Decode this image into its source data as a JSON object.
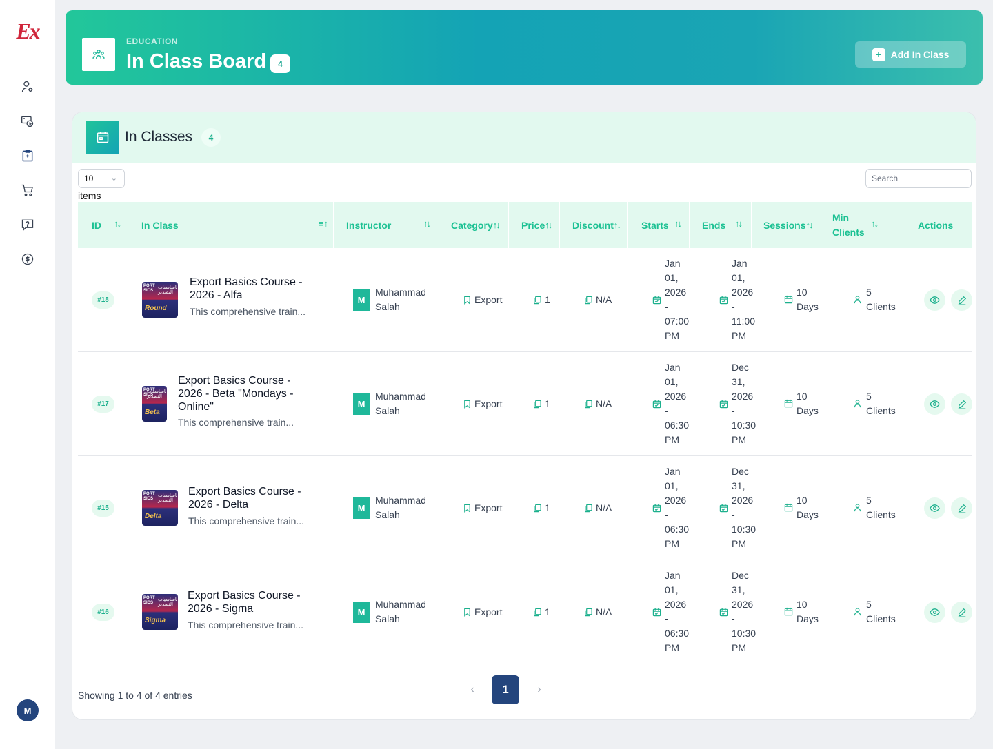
{
  "app": {
    "logo_text": "Ex",
    "user_initial": "M"
  },
  "sidebar": {
    "items": [
      {
        "icon": "user-gear-icon"
      },
      {
        "icon": "money-transfer-icon"
      },
      {
        "icon": "clipboard-icon",
        "active": true
      },
      {
        "icon": "cart-icon"
      },
      {
        "icon": "question-icon"
      },
      {
        "icon": "dollar-icon"
      }
    ]
  },
  "header": {
    "section": "EDUCATION",
    "title": "In Class Board",
    "count": "4",
    "add_button": "Add In Class"
  },
  "card": {
    "title": "In Classes",
    "count": "4",
    "page_length": "10",
    "page_length_label": "items",
    "search_placeholder": "Search"
  },
  "table": {
    "columns": {
      "id": "ID",
      "in_class": "In Class",
      "instructor": "Instructor",
      "category": "Category",
      "price": "Price",
      "discount": "Discount",
      "starts": "Starts",
      "ends": "Ends",
      "sessions": "Sessions",
      "min_clients_1": "Min",
      "min_clients_2": "Clients",
      "actions": "Actions"
    },
    "rows": [
      {
        "id": "#18",
        "thumb_label": "Round",
        "title_1": "Export Basics Course -",
        "title_2": "2026 - Alfa",
        "title_3": "",
        "desc": "This comprehensive train...",
        "instructor_initial": "M",
        "instructor_1": "Muhammad",
        "instructor_2": "Salah",
        "category": "Export",
        "price": "1",
        "discount": "N/A",
        "starts": [
          "Jan",
          "01,",
          "2026",
          "-",
          "07:00",
          "PM"
        ],
        "ends": [
          "Jan",
          "01,",
          "2026",
          "-",
          "11:00",
          "PM"
        ],
        "sessions_1": "10",
        "sessions_2": "Days",
        "clients_1": "5",
        "clients_2": "Clients"
      },
      {
        "id": "#17",
        "thumb_label": "Beta",
        "title_1": "Export Basics Course -",
        "title_2": "2026 - Beta \"Mondays -",
        "title_3": "Online\"",
        "desc": "This comprehensive train...",
        "instructor_initial": "M",
        "instructor_1": "Muhammad",
        "instructor_2": "Salah",
        "category": "Export",
        "price": "1",
        "discount": "N/A",
        "starts": [
          "Jan",
          "01,",
          "2026",
          "-",
          "06:30",
          "PM"
        ],
        "ends": [
          "Dec",
          "31,",
          "2026",
          "-",
          "10:30",
          "PM"
        ],
        "sessions_1": "10",
        "sessions_2": "Days",
        "clients_1": "5",
        "clients_2": "Clients"
      },
      {
        "id": "#15",
        "thumb_label": "Delta",
        "title_1": "Export Basics Course -",
        "title_2": "2026 - Delta",
        "title_3": "",
        "desc": "This comprehensive train...",
        "instructor_initial": "M",
        "instructor_1": "Muhammad",
        "instructor_2": "Salah",
        "category": "Export",
        "price": "1",
        "discount": "N/A",
        "starts": [
          "Jan",
          "01,",
          "2026",
          "-",
          "06:30",
          "PM"
        ],
        "ends": [
          "Dec",
          "31,",
          "2026",
          "-",
          "10:30",
          "PM"
        ],
        "sessions_1": "10",
        "sessions_2": "Days",
        "clients_1": "5",
        "clients_2": "Clients"
      },
      {
        "id": "#16",
        "thumb_label": "Sigma",
        "title_1": "Export Basics Course -",
        "title_2": "2026 - Sigma",
        "title_3": "",
        "desc": "This comprehensive train...",
        "instructor_initial": "M",
        "instructor_1": "Muhammad",
        "instructor_2": "Salah",
        "category": "Export",
        "price": "1",
        "discount": "N/A",
        "starts": [
          "Jan",
          "01,",
          "2026",
          "-",
          "06:30",
          "PM"
        ],
        "ends": [
          "Dec",
          "31,",
          "2026",
          "-",
          "10:30",
          "PM"
        ],
        "sessions_1": "10",
        "sessions_2": "Days",
        "clients_1": "5",
        "clients_2": "Clients"
      }
    ]
  },
  "pagination": {
    "summary": "Showing 1 to 4 of 4 entries",
    "current_page": "1",
    "prev": "‹",
    "next": "›"
  },
  "colors": {
    "accent": "#1cc193",
    "header_bg": "#e2f9ef",
    "primary_dark": "#24457d",
    "logo": "#d0263b"
  }
}
